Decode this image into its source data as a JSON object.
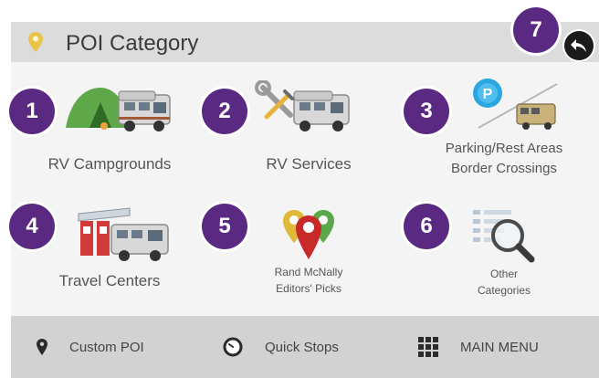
{
  "header": {
    "title": "POI Category",
    "back_icon": "back-arrow-icon"
  },
  "callouts": [
    "1",
    "2",
    "3",
    "4",
    "5",
    "6",
    "7"
  ],
  "categories": [
    {
      "label": "RV Campgrounds",
      "icon": "tent-and-rv-icon"
    },
    {
      "label": "RV Services",
      "icon": "wrench-and-rv-icon"
    },
    {
      "label_line1": "Parking/Rest Areas",
      "label_line2": "Border Crossings",
      "icon": "parking-rv-icon"
    },
    {
      "label": "Travel Centers",
      "icon": "fuel-station-rv-icon"
    },
    {
      "label_line1": "Rand McNally",
      "label_line2": "Editors' Picks",
      "icon": "map-pins-icon"
    },
    {
      "label_line1": "Other",
      "label_line2": "Categories",
      "icon": "magnifier-list-icon"
    }
  ],
  "footer": {
    "custom_poi": "Custom POI",
    "quick_stops": "Quick Stops",
    "main_menu": "MAIN MENU"
  },
  "colors": {
    "badge": "#5a2a82",
    "header_bg": "#dcdcdc",
    "footer_bg": "#d2d2d2",
    "pin_yellow": "#e9c44a"
  }
}
